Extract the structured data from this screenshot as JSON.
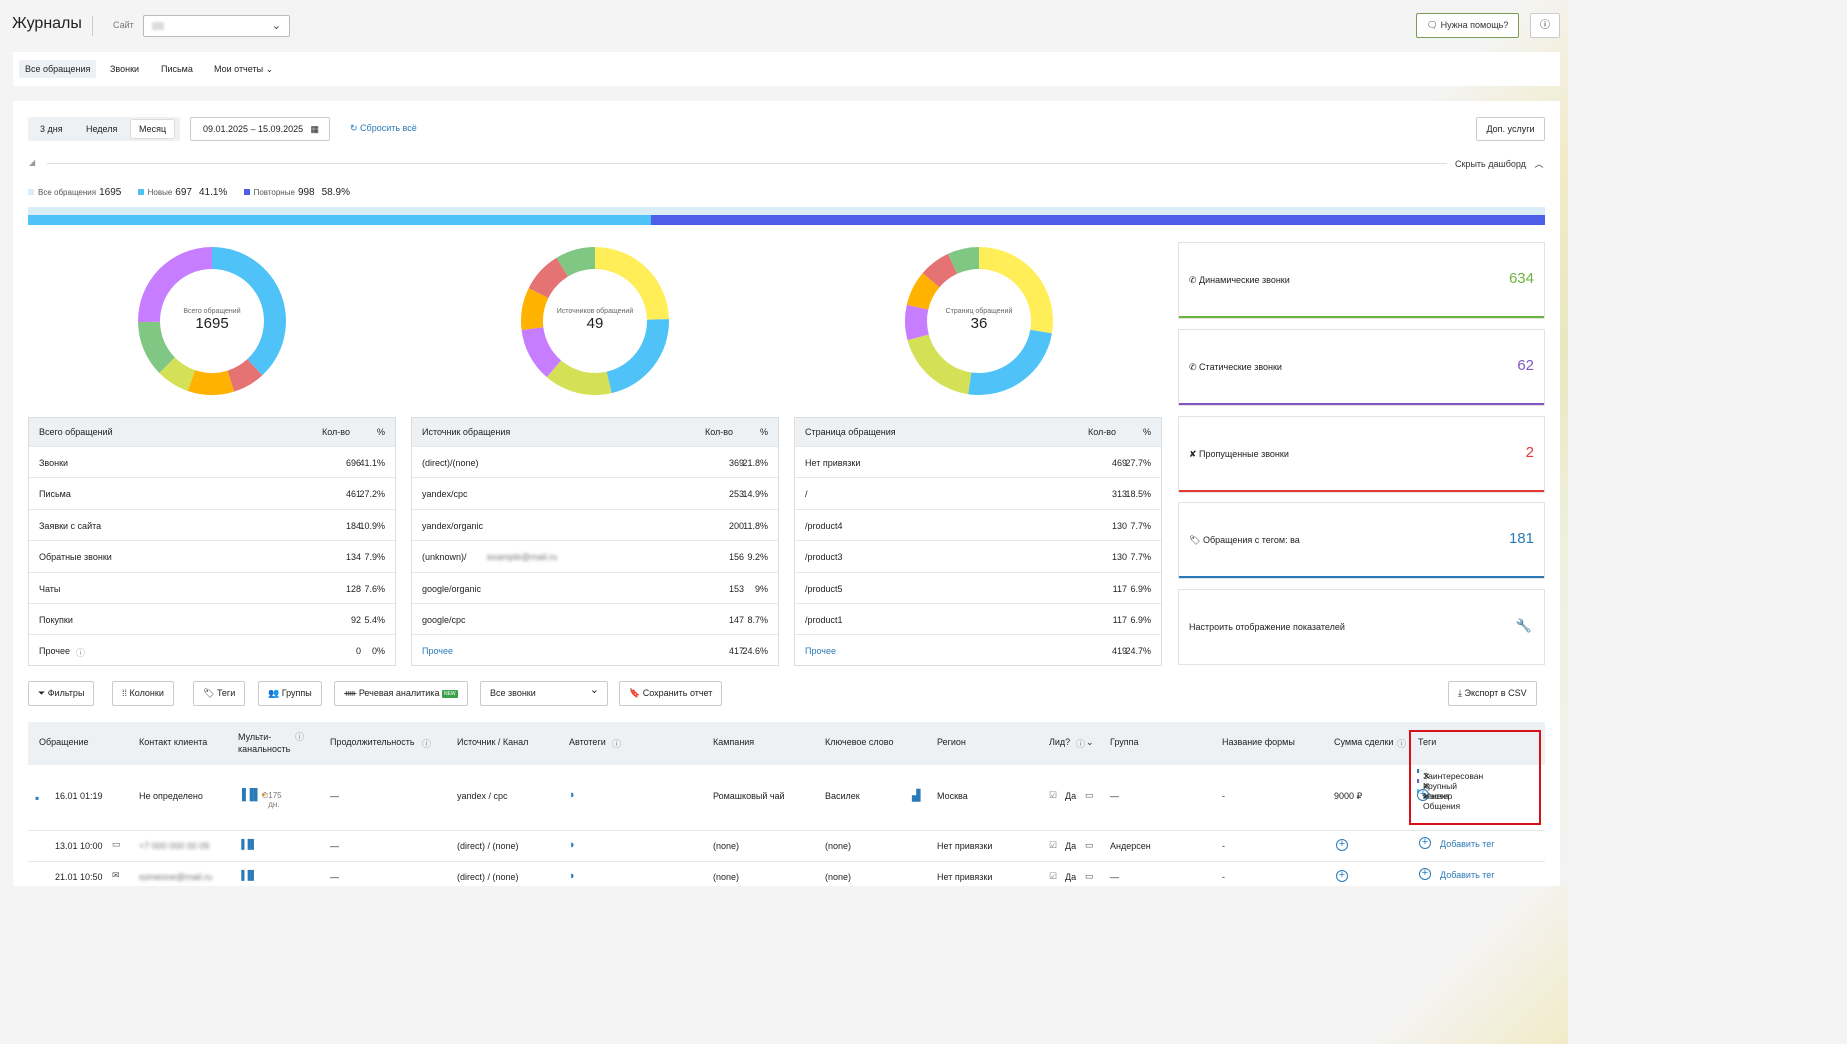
{
  "header": {
    "title": "Журналы",
    "site_label": "Сайт",
    "help_label": "Нужна помощь?",
    "info_icon": "info-icon"
  },
  "tabs": [
    "Все обращения",
    "Звонки",
    "Письма",
    "Мои отчеты"
  ],
  "period": {
    "options": [
      "3 дня",
      "Неделя",
      "Месяц"
    ],
    "selected": "Месяц",
    "dates": "09.01.2025 – 15.09.2025",
    "reset_label": "Сбросить всё",
    "extra_label": "Доп. услуги",
    "hide_dashboard": "Скрыть дашборд"
  },
  "summary": {
    "all_label": "Все обращения",
    "all_value": "1695",
    "new_label": "Новые",
    "new_value": "697",
    "new_pct": "41.1%",
    "repeat_label": "Повторные",
    "repeat_value": "998",
    "repeat_pct": "58.9%",
    "new_fraction": 0.411,
    "colors": {
      "all": "#d9eef9",
      "new": "#4fc2f7",
      "repeat": "#4d5fe6"
    }
  },
  "donuts": [
    {
      "label": "Всего обращений",
      "value": "1695",
      "segments": [
        {
          "v": 41.1,
          "c": "#4fc2f7"
        },
        {
          "v": 7.6,
          "c": "#e57373"
        },
        {
          "v": 10.9,
          "c": "#ffb300"
        },
        {
          "v": 7.9,
          "c": "#d4e157"
        },
        {
          "v": 13.1,
          "c": "#81c784"
        },
        {
          "v": 27.2,
          "c": "#c77dff"
        }
      ]
    },
    {
      "label": "Источников обращений",
      "value": "49",
      "segments": [
        {
          "v": 24.6,
          "c": "#ffee58"
        },
        {
          "v": 21.8,
          "c": "#4fc2f7"
        },
        {
          "v": 14.9,
          "c": "#d4e157"
        },
        {
          "v": 11.8,
          "c": "#c77dff"
        },
        {
          "v": 9.2,
          "c": "#ffb300"
        },
        {
          "v": 9,
          "c": "#e57373"
        },
        {
          "v": 8.7,
          "c": "#81c784"
        }
      ]
    },
    {
      "label": "Страниц обращений",
      "value": "36",
      "segments": [
        {
          "v": 27.7,
          "c": "#ffee58"
        },
        {
          "v": 24.7,
          "c": "#4fc2f7"
        },
        {
          "v": 18.5,
          "c": "#d4e157"
        },
        {
          "v": 7.7,
          "c": "#c77dff"
        },
        {
          "v": 7.7,
          "c": "#ffb300"
        },
        {
          "v": 6.9,
          "c": "#e57373"
        },
        {
          "v": 6.9,
          "c": "#81c784"
        }
      ]
    }
  ],
  "tables": [
    {
      "h": [
        "Всего обращений",
        "Кол-во",
        "%"
      ],
      "rows": [
        [
          "Звонки",
          "696",
          "41.1%"
        ],
        [
          "Письма",
          "461",
          "27.2%"
        ],
        [
          "Заявки с сайта",
          "184",
          "10.9%"
        ],
        [
          "Обратные звонки",
          "134",
          "7.9%"
        ],
        [
          "Чаты",
          "128",
          "7.6%"
        ],
        [
          "Покупки",
          "92",
          "5.4%"
        ],
        [
          "Прочее",
          "0",
          "0%"
        ]
      ]
    },
    {
      "h": [
        "Источник обращения",
        "Кол-во",
        "%"
      ],
      "rows": [
        [
          "(direct)/(none)",
          "369",
          "21.8%"
        ],
        [
          "yandex/cpc",
          "253",
          "14.9%"
        ],
        [
          "yandex/organic",
          "200",
          "11.8%"
        ],
        [
          "(unknown)/",
          "156",
          "9.2%"
        ],
        [
          "google/organic",
          "153",
          "9%"
        ],
        [
          "google/cpc",
          "147",
          "8.7%"
        ],
        [
          "Прочее",
          "417",
          "24.6%"
        ]
      ]
    },
    {
      "h": [
        "Страница обращения",
        "Кол-во",
        "%"
      ],
      "rows": [
        [
          "Нет привязки",
          "469",
          "27.7%"
        ],
        [
          "/",
          "313",
          "18.5%"
        ],
        [
          "/product4",
          "130",
          "7.7%"
        ],
        [
          "/product3",
          "130",
          "7.7%"
        ],
        [
          "/product5",
          "117",
          "6.9%"
        ],
        [
          "/product1",
          "117",
          "6.9%"
        ],
        [
          "Прочее",
          "419",
          "24.7%"
        ]
      ]
    }
  ],
  "cards": [
    {
      "label": "Динамические звонки",
      "value": "634",
      "color": "#6cb33f",
      "icon": "phone-icon"
    },
    {
      "label": "Статические звонки",
      "value": "62",
      "color": "#7e57c2",
      "icon": "phone-icon"
    },
    {
      "label": "Пропущенные звонки",
      "value": "2",
      "color": "#e53935",
      "icon": "missed-call-icon"
    },
    {
      "label": "Обращения с тегом: ва",
      "value": "181",
      "color": "#2a7ab8",
      "icon": "tag-icon"
    }
  ],
  "configure_label": "Настроить отображение показателей",
  "toolbar": {
    "filters": "Фильтры",
    "columns": "Колонки",
    "tags": "Теги",
    "groups": "Группы",
    "speech": "Речевая аналитика",
    "new_badge": "NEW",
    "calls_select": "Все звонки",
    "save": "Сохранить отчет",
    "export": "Экспорт в CSV"
  },
  "grid": {
    "headers": [
      "Обращение",
      "Контакт клиента",
      "Мульти-канальность",
      "Продолжительность",
      "Источник / Канал",
      "Автотеги",
      "Кампания",
      "Ключевое слово",
      "Регион",
      "Лид?",
      "Группа",
      "Название формы",
      "Сумма сделки",
      "Теги"
    ],
    "rows": [
      {
        "date": "16.01 01:19",
        "contact": "Не определено",
        "multi_days": "175 дн.",
        "duration": "—",
        "source": "yandex / cpc",
        "campaign": "Ромашковый чай",
        "keyword": "Василек",
        "region": "Москва",
        "lead": "Да",
        "group": "—",
        "form": "-",
        "sum": "9000 ₽",
        "tags": [
          "Заинтересован",
          "Крупный клиент",
          "Мастер Общения"
        ],
        "tag_colors": [
          "#2a7ab8",
          "#7e57c2",
          "#4fc2f7"
        ]
      },
      {
        "date": "13.01 10:00",
        "contact": "",
        "duration": "—",
        "source": "(direct) / (none)",
        "campaign": "(none)",
        "keyword": "(none)",
        "region": "Нет привязки",
        "lead": "Да",
        "group": "Андерсен",
        "form": "-",
        "add_tag": "Добавить тег"
      },
      {
        "date": "21.01 10:50",
        "contact": "",
        "duration": "—",
        "source": "(direct) / (none)",
        "campaign": "(none)",
        "keyword": "(none)",
        "region": "Нет привязки",
        "lead": "Да",
        "group": "—",
        "form": "-",
        "add_tag": "Добавить тег"
      }
    ]
  }
}
